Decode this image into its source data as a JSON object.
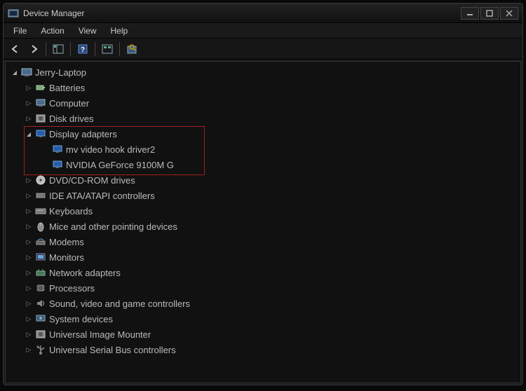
{
  "window": {
    "title": "Device Manager"
  },
  "menu": {
    "file": "File",
    "action": "Action",
    "view": "View",
    "help": "Help"
  },
  "tree": {
    "root": "Jerry-Laptop",
    "nodes": [
      {
        "label": "Batteries",
        "icon": "battery"
      },
      {
        "label": "Computer",
        "icon": "computer"
      },
      {
        "label": "Disk drives",
        "icon": "disk"
      },
      {
        "label": "Display adapters",
        "icon": "display",
        "expanded": true,
        "children": [
          {
            "label": "mv video hook driver2",
            "icon": "display"
          },
          {
            "label": "NVIDIA GeForce 9100M G",
            "icon": "display"
          }
        ]
      },
      {
        "label": "DVD/CD-ROM drives",
        "icon": "dvd"
      },
      {
        "label": "IDE ATA/ATAPI controllers",
        "icon": "ide"
      },
      {
        "label": "Keyboards",
        "icon": "keyboard"
      },
      {
        "label": "Mice and other pointing devices",
        "icon": "mouse"
      },
      {
        "label": "Modems",
        "icon": "modem"
      },
      {
        "label": "Monitors",
        "icon": "monitor"
      },
      {
        "label": "Network adapters",
        "icon": "network"
      },
      {
        "label": "Processors",
        "icon": "cpu"
      },
      {
        "label": "Sound, video and game controllers",
        "icon": "sound"
      },
      {
        "label": "System devices",
        "icon": "system"
      },
      {
        "label": "Universal Image Mounter",
        "icon": "disk"
      },
      {
        "label": "Universal Serial Bus controllers",
        "icon": "usb"
      }
    ]
  }
}
